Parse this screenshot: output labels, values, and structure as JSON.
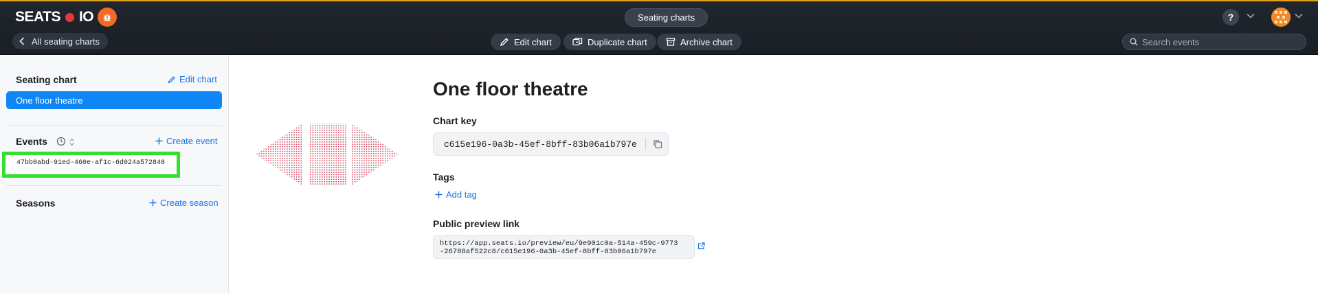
{
  "header": {
    "logo_left": "SEATS",
    "logo_right": "IO",
    "back_label": "All seating charts",
    "page_pill": "Seating charts",
    "actions": {
      "edit": "Edit chart",
      "duplicate": "Duplicate chart",
      "archive": "Archive chart"
    },
    "help_label": "?",
    "search_placeholder": "Search events",
    "colors": {
      "accent": "#e0a11b",
      "logo_dot": "#e53935",
      "logo_badge": "#f26a21"
    }
  },
  "sidebar": {
    "seating_chart": {
      "heading": "Seating chart",
      "edit_link": "Edit chart",
      "selected_chart": "One floor theatre"
    },
    "events": {
      "heading": "Events",
      "create_link": "Create event",
      "items": [
        "47bb0abd-91ed-460e-af1c-6d024a572848"
      ]
    },
    "seasons": {
      "heading": "Seasons",
      "create_link": "Create season"
    }
  },
  "main": {
    "title": "One floor theatre",
    "chart_key": {
      "label": "Chart key",
      "value": "c615e196-0a3b-45ef-8bff-83b06a1b797e"
    },
    "tags": {
      "label": "Tags",
      "add_label": "Add tag"
    },
    "public_preview": {
      "label": "Public preview link",
      "line1": "https://app.seats.io/preview/eu/9e901c0a-514a-459c-9773",
      "line2": "-26788af522c8/c615e196-0a3b-45ef-8bff-83b06a1b797e"
    },
    "colors": {
      "link": "#1a73e8",
      "selected": "#0e86f5",
      "seat": "#d0425a",
      "highlight": "#33e02c"
    }
  }
}
